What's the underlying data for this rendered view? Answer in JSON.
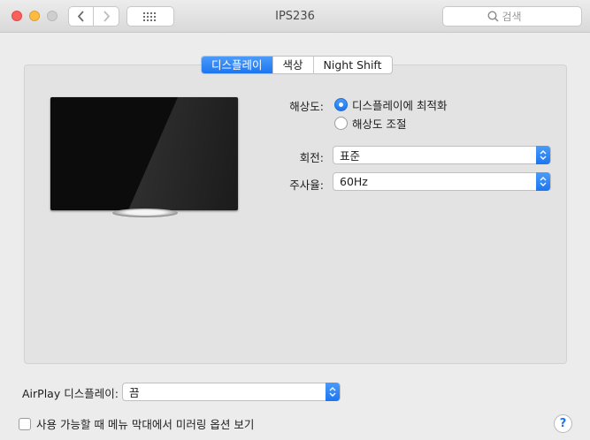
{
  "window": {
    "title": "IPS236"
  },
  "toolbar": {
    "back_icon": "chevron-left-icon",
    "forward_icon": "chevron-right-icon",
    "grid_icon": "grid-icon",
    "search_placeholder": "검색"
  },
  "tabs": [
    {
      "label": "디스플레이",
      "active": true
    },
    {
      "label": "색상",
      "active": false
    },
    {
      "label": "Night Shift",
      "active": false
    }
  ],
  "resolution": {
    "label": "해상도:",
    "options": [
      {
        "label": "디스플레이에 최적화",
        "selected": true
      },
      {
        "label": "해상도 조절",
        "selected": false
      }
    ]
  },
  "rotation": {
    "label": "회전:",
    "value": "표준"
  },
  "refresh": {
    "label": "주사율:",
    "value": "60Hz"
  },
  "airplay": {
    "label": "AirPlay 디스플레이:",
    "value": "끔"
  },
  "mirroring": {
    "label": "사용 가능할 때 메뉴 막대에서 미러링 옵션 보기",
    "checked": false
  },
  "help": {
    "label": "?"
  },
  "colors": {
    "accent": "#1d76f0"
  }
}
